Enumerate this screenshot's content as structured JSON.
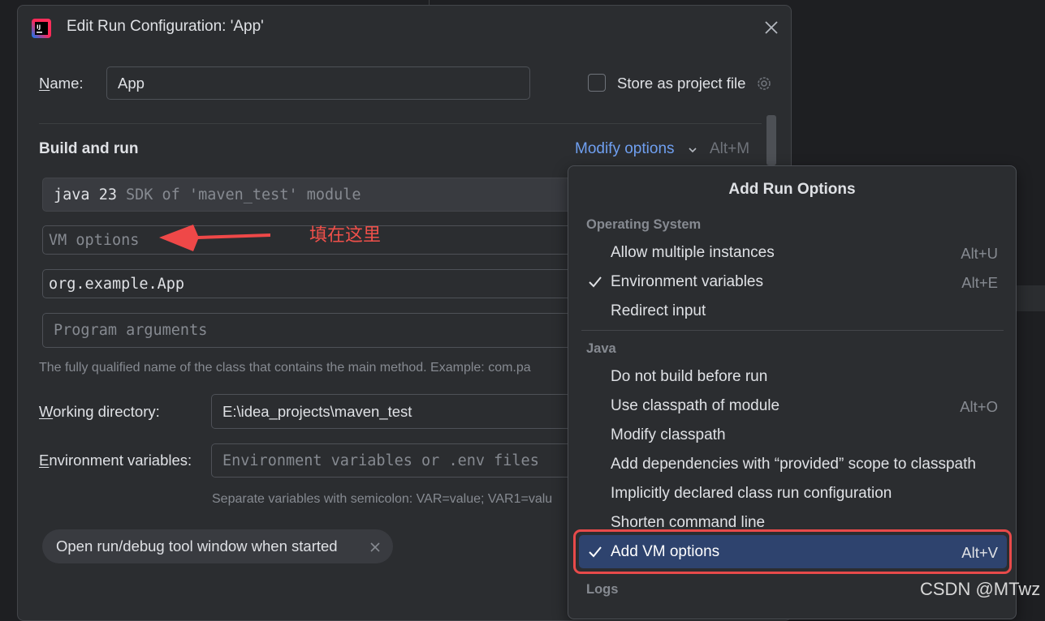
{
  "dialog": {
    "title": "Edit Run Configuration: 'App'"
  },
  "name": {
    "label_first": "N",
    "label_rest": "ame:",
    "value": "App"
  },
  "store_project": {
    "label": "Store as project file",
    "checked": false
  },
  "build_and_run": {
    "title": "Build and run",
    "modify_label": "Modify options",
    "modify_shortcut": "Alt+M",
    "sdk_main": "java 23",
    "sdk_sub": "SDK of 'maven_test' module",
    "vm_options_placeholder": "VM options",
    "main_class": "org.example.App",
    "program_args_placeholder": "Program arguments",
    "main_class_hint": "The fully qualified name of the class that contains the main method. Example: com.pa"
  },
  "working_dir": {
    "label_first": "W",
    "label_rest": "orking directory:",
    "value": "E:\\idea_projects\\maven_test"
  },
  "env_vars": {
    "label_first": "E",
    "label_rest": "nvironment variables:",
    "placeholder": "Environment variables or .env files",
    "hint": "Separate variables with semicolon: VAR=value; VAR1=valu"
  },
  "chip": {
    "label": "Open run/debug tool window when started"
  },
  "annotation": {
    "text": "填在这里"
  },
  "popup": {
    "title": "Add Run Options",
    "groups": {
      "os": "Operating System",
      "java": "Java",
      "logs": "Logs"
    },
    "os_items": [
      {
        "label": "Allow multiple instances",
        "shortcut": "Alt+U",
        "checked": false
      },
      {
        "label": "Environment variables",
        "shortcut": "Alt+E",
        "checked": true
      },
      {
        "label": "Redirect input",
        "shortcut": "",
        "checked": false
      }
    ],
    "java_items": [
      {
        "label": "Do not build before run",
        "shortcut": "",
        "checked": false
      },
      {
        "label": "Use classpath of module",
        "shortcut": "Alt+O",
        "checked": false
      },
      {
        "label": "Modify classpath",
        "shortcut": "",
        "checked": false
      },
      {
        "label": "Add dependencies with “provided” scope to classpath",
        "shortcut": "",
        "checked": false
      },
      {
        "label": "Implicitly declared class run configuration",
        "shortcut": "",
        "checked": false
      },
      {
        "label": "Shorten command line",
        "shortcut": "",
        "checked": false
      },
      {
        "label": "Add VM options",
        "shortcut": "Alt+V",
        "checked": true,
        "selected": true
      }
    ]
  },
  "watermark": "CSDN @MTwz",
  "colors": {
    "accent_link": "#6f9ff0",
    "selection": "#2e436e",
    "annotation_red": "#e84a4a"
  }
}
